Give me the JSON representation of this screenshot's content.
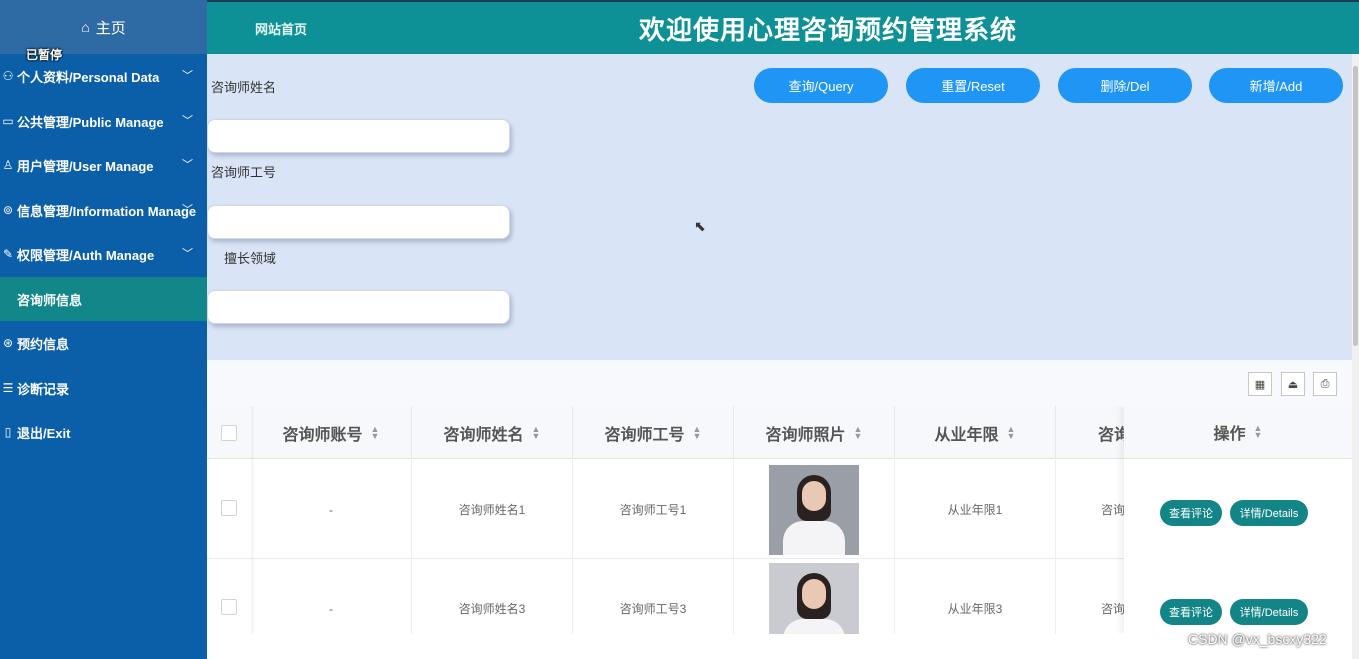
{
  "sidebar": {
    "home_label": "主页",
    "paused_label": "已暂停",
    "items": [
      {
        "label": "个人资料/Personal Data",
        "icon": "user-card-icon",
        "glyph": "👤",
        "has_chevron": true
      },
      {
        "label": "公共管理/Public Manage",
        "icon": "monitor-icon",
        "glyph": "🖥",
        "has_chevron": true
      },
      {
        "label": "用户管理/User Manage",
        "icon": "user-icon",
        "glyph": "👤",
        "has_chevron": true
      },
      {
        "label": "信息管理/Information Manage",
        "icon": "info-icon",
        "glyph": "ⓘ",
        "has_chevron": true
      },
      {
        "label": "权限管理/Auth Manage",
        "icon": "key-icon",
        "glyph": "✎",
        "has_chevron": true
      },
      {
        "label": "咨询师信息",
        "icon": "",
        "glyph": "",
        "has_chevron": false,
        "active": true
      },
      {
        "label": "预约信息",
        "icon": "calendar-icon",
        "glyph": "◎",
        "has_chevron": false
      },
      {
        "label": "诊断记录",
        "icon": "record-icon",
        "glyph": "☰",
        "has_chevron": false
      },
      {
        "label": "退出/Exit",
        "icon": "exit-icon",
        "glyph": "▯",
        "has_chevron": false
      }
    ]
  },
  "header": {
    "site_link": "网站首页",
    "title": "欢迎使用心理咨询预约管理系统"
  },
  "search": {
    "fields": [
      {
        "label": "咨询师姓名",
        "value": ""
      },
      {
        "label": "咨询师工号",
        "value": ""
      },
      {
        "label": "擅长领域",
        "value": ""
      }
    ],
    "buttons": {
      "query": "查询/Query",
      "reset": "重置/Reset",
      "delete": "删除/Del",
      "add": "新增/Add"
    }
  },
  "table": {
    "columns": [
      "咨询师账号",
      "咨询师姓名",
      "咨询师工号",
      "咨询师照片",
      "从业年限",
      "咨询",
      "操作"
    ],
    "rows": [
      {
        "account": "-",
        "name": "咨询师姓名1",
        "number": "咨询师工号1",
        "years": "从业年限1",
        "partial": "咨询"
      },
      {
        "account": "-",
        "name": "咨询师姓名3",
        "number": "咨询师工号3",
        "years": "从业年限3",
        "partial": "咨询"
      }
    ],
    "actions": {
      "review": "查看评论",
      "details": "详情/Details"
    }
  },
  "watermark": "CSDN @vx_bscxy322",
  "colors": {
    "sidebar": "#0b5fa8",
    "header": "#0e9196",
    "button": "#1f96f5",
    "op_button": "#138587",
    "search_bg": "#d9e4f7"
  }
}
